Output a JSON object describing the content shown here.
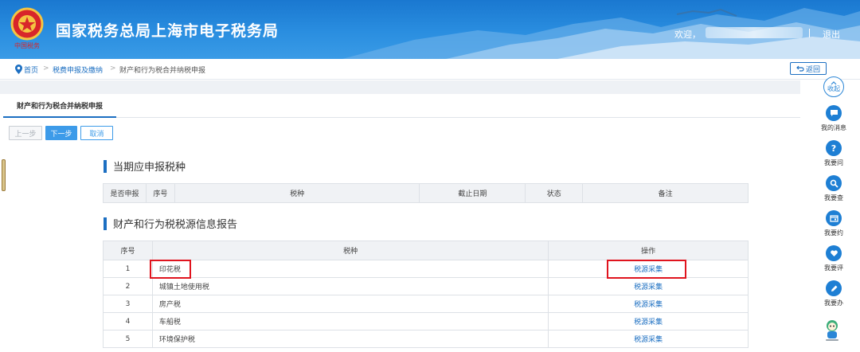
{
  "header": {
    "title": "国家税务总局上海市电子税务局",
    "emblem_text": "中国税务",
    "welcome": "欢迎，",
    "logout": "退出"
  },
  "breadcrumb": {
    "home": "首页",
    "level1": "税费申报及缴纳",
    "current": "财产和行为税合并纳税申报",
    "separator": ">"
  },
  "back_button": "返回",
  "tab": {
    "label": "财产和行为税合并纳税申报"
  },
  "toolbar": {
    "prev": "上一步",
    "next": "下一步",
    "cancel": "取消"
  },
  "section1": {
    "title": "当期应申报税种",
    "headers": [
      "是否申报",
      "序号",
      "税种",
      "截止日期",
      "状态",
      "备注"
    ]
  },
  "section2": {
    "title": "财产和行为税税源信息报告",
    "headers": [
      "序号",
      "税种",
      "操作"
    ],
    "rows": [
      {
        "num": "1",
        "name": "印花税",
        "op": "税源采集"
      },
      {
        "num": "2",
        "name": "城镇土地使用税",
        "op": "税源采集"
      },
      {
        "num": "3",
        "name": "房产税",
        "op": "税源采集"
      },
      {
        "num": "4",
        "name": "车船税",
        "op": "税源采集"
      },
      {
        "num": "5",
        "name": "环境保护税",
        "op": "税源采集"
      }
    ]
  },
  "side_panel": {
    "collapse": "收起",
    "items": [
      {
        "label": "我的消息",
        "icon": "message-icon"
      },
      {
        "label": "我要问",
        "icon": "question-icon"
      },
      {
        "label": "我要查",
        "icon": "search-icon"
      },
      {
        "label": "我要约",
        "icon": "calendar-icon"
      },
      {
        "label": "我要评",
        "icon": "heart-icon"
      },
      {
        "label": "我要办",
        "icon": "pen-icon"
      }
    ]
  },
  "colors": {
    "primary": "#1c6fc2",
    "highlight": "#e0141e",
    "header": "#2a8ee0"
  }
}
